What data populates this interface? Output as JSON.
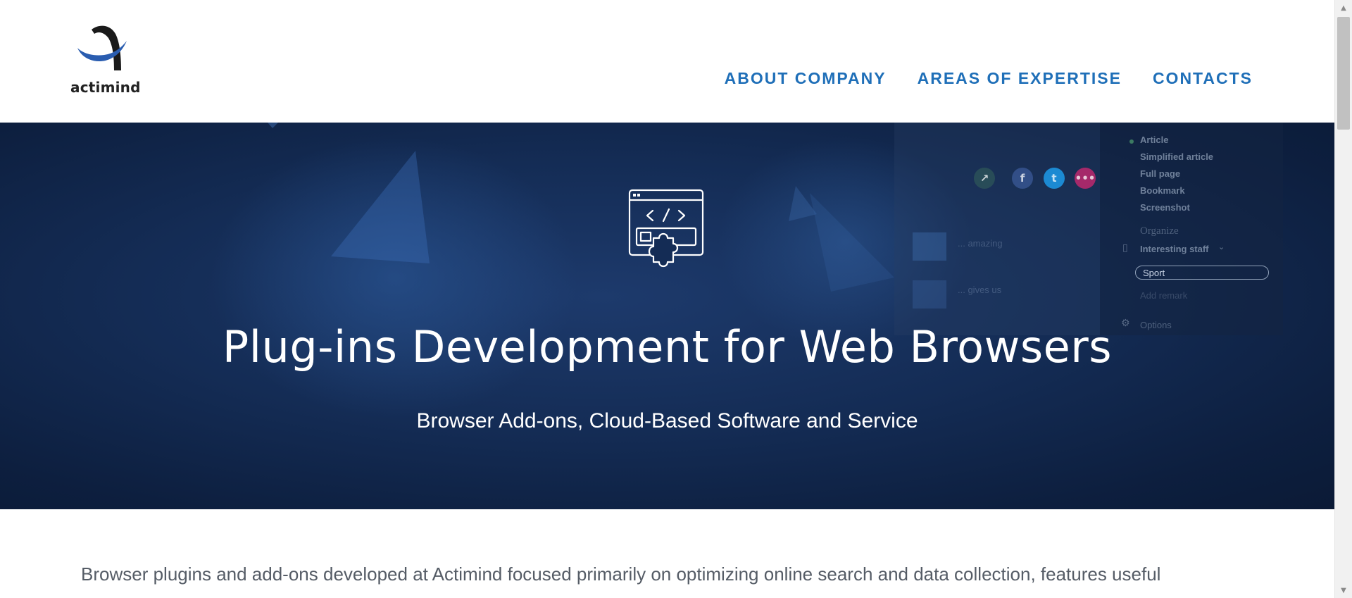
{
  "brand": {
    "name": "actimind",
    "colors": {
      "logo_blue": "#2a5db0",
      "logo_black": "#1a1a1a"
    }
  },
  "nav": {
    "items": [
      {
        "label": "ABOUT COMPANY"
      },
      {
        "label": "AREAS OF EXPERTISE"
      },
      {
        "label": "CONTACTS"
      }
    ],
    "color": "#1f6fb8"
  },
  "hero": {
    "icon": "browser-plugin-icon",
    "title": "Plug-ins Development for Web Browsers",
    "subtitle": "Browser Add-ons, Cloud-Based Software and Service",
    "background": {
      "panel_items": [
        "Article",
        "Simplified article",
        "Full page",
        "Bookmark",
        "Screenshot"
      ],
      "organize_heading": "Organize",
      "folder_label": "Interesting staff",
      "tag_input_value": "Sport",
      "remark_placeholder": "Add remark",
      "options_label": "Options",
      "card_texts": [
        "... amazing",
        "... gives us"
      ]
    }
  },
  "intro": {
    "text": "Browser plugins and add-ons developed at Actimind focused primarily on optimizing online search and data collection, features useful"
  }
}
